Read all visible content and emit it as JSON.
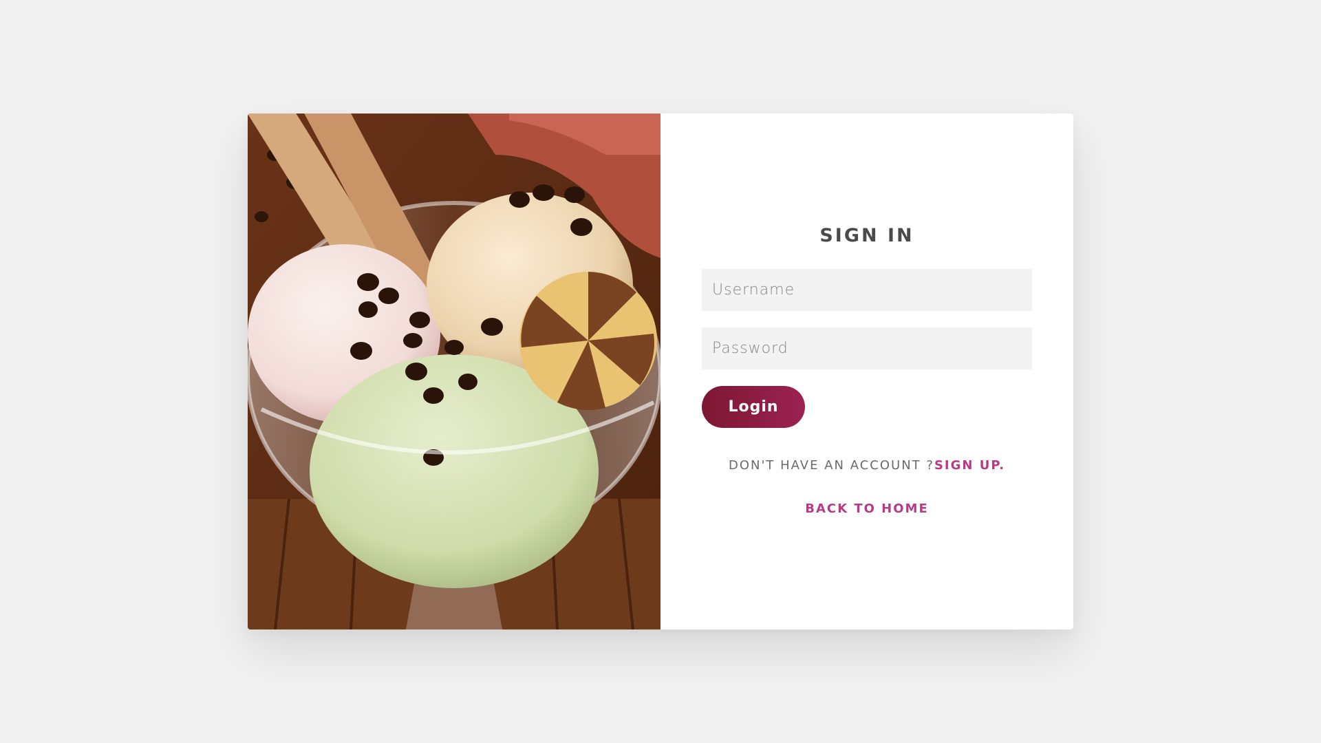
{
  "signin": {
    "title": "SIGN IN",
    "username_placeholder": "Username",
    "password_placeholder": "Password",
    "login_label": "Login",
    "no_account_text": "DON'T HAVE AN ACCOUNT ?",
    "signup_label": "SIGN UP.",
    "back_home_label": "BACK TO HOME"
  },
  "colors": {
    "page_bg": "#f1f1f1",
    "button_gradient_start": "#7d1733",
    "button_gradient_end": "#9b2252",
    "link_accent": "#b73b84",
    "input_bg": "#f3f3f3"
  },
  "image": {
    "subject": "ice-cream-sundae-photo"
  }
}
